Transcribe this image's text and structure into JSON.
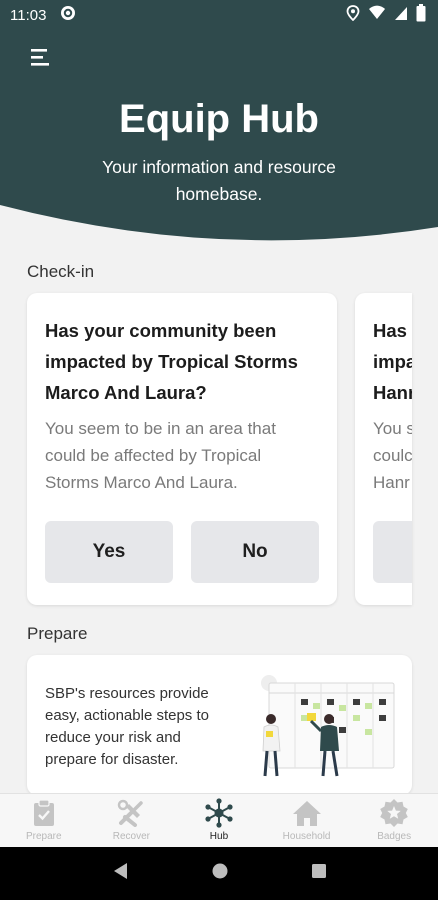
{
  "status_bar": {
    "time": "11:03"
  },
  "header": {
    "title": "Equip Hub",
    "subtitle": "Your information and resource homebase."
  },
  "checkin": {
    "label": "Check-in",
    "cards": [
      {
        "title": "Has your community been impacted by Tropical Storms Marco And Laura?",
        "body": "You seem to be in an area that could be affected by Tropical Storms Marco And Laura.",
        "yes_label": "Yes",
        "no_label": "No"
      },
      {
        "title_lines": [
          "Has",
          "impa",
          "Hanr"
        ],
        "body_lines": [
          "You s",
          "coulc",
          "Hanr"
        ]
      }
    ]
  },
  "prepare": {
    "label": "Prepare",
    "description": "SBP's resources provide easy, actionable steps to reduce your risk and prepare for disaster."
  },
  "bottom_nav": {
    "items": [
      {
        "label": "Prepare",
        "icon": "clipboard-check-icon"
      },
      {
        "label": "Recover",
        "icon": "tools-icon"
      },
      {
        "label": "Hub",
        "icon": "network-hub-icon"
      },
      {
        "label": "Household",
        "icon": "house-icon"
      },
      {
        "label": "Badges",
        "icon": "star-badge-icon"
      }
    ],
    "active": "Hub"
  },
  "colors": {
    "header_bg": "#2f4a4c",
    "page_bg": "#f2f2f2",
    "button_bg": "#e6e7ea"
  }
}
